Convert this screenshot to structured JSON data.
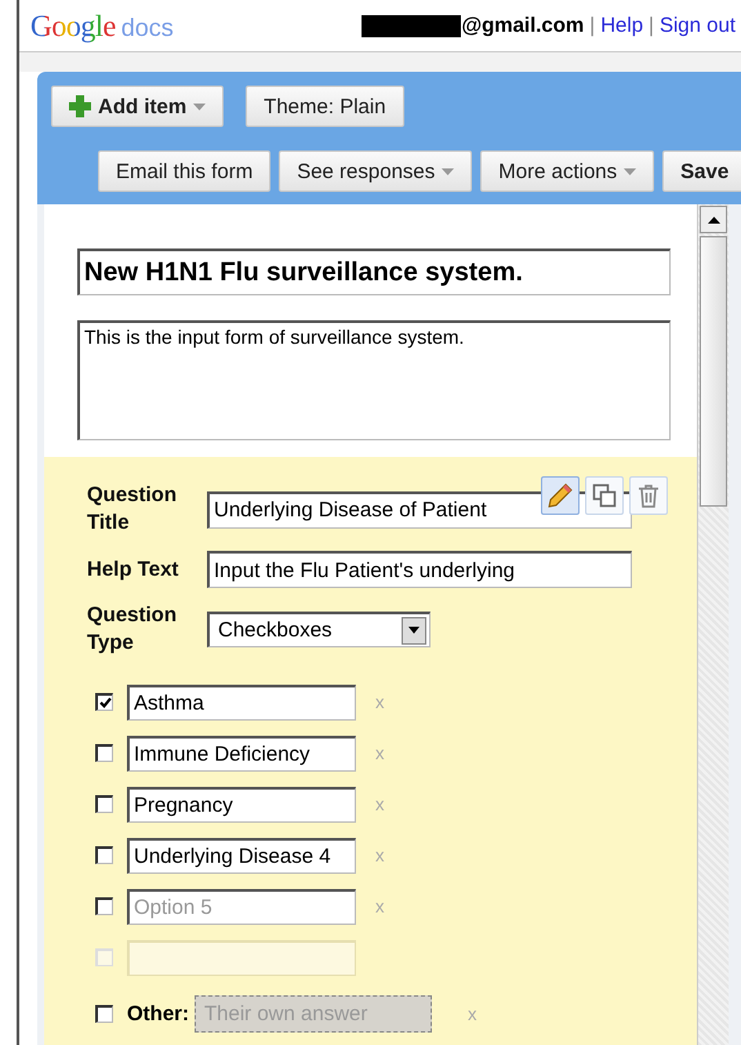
{
  "header": {
    "logo": "Google",
    "product": "docs",
    "account": "@gmail.com",
    "links": [
      {
        "separator": "|",
        "label": "Help"
      },
      {
        "separator": "|",
        "label": "Sign out"
      }
    ]
  },
  "toolbar": {
    "row_1": [
      {
        "kind": "add",
        "label": "Add item",
        "menu": true
      },
      {
        "kind": "plain",
        "label": "Theme:  Plain",
        "menu": false
      }
    ],
    "row_2": [
      {
        "kind": "plain",
        "label": "Email this form",
        "menu": false
      },
      {
        "kind": "plain",
        "label": "See responses",
        "menu": true
      },
      {
        "kind": "plain",
        "label": "More actions",
        "menu": true
      },
      {
        "kind": "bold",
        "label": "Save",
        "menu": false
      }
    ]
  },
  "form": {
    "title": "New H1N1 Flu surveillance system.",
    "description": "This is the input form of surveillance system.",
    "question": {
      "title_label": "Question Title",
      "title_value": "Underlying Disease of Patient",
      "help_label": "Help Text",
      "help_value": "Input the Flu Patient's underlying",
      "type_label": "Question Type",
      "type_value": "Checkboxes",
      "options": [
        {
          "kind": "option",
          "value": "Asthma",
          "checked": true,
          "remove": "x"
        },
        {
          "kind": "option",
          "value": "Immune Deficiency",
          "checked": false,
          "remove": "x"
        },
        {
          "kind": "option",
          "value": "Pregnancy",
          "checked": false,
          "remove": "x"
        },
        {
          "kind": "option",
          "value": "Underlying Disease 4",
          "checked": false,
          "remove": "x"
        },
        {
          "kind": "option",
          "placeholder": "Option 5",
          "checked": false,
          "remove": "x"
        },
        {
          "kind": "new",
          "checked": false,
          "disabled": true
        }
      ],
      "other": {
        "label": "Other:",
        "placeholder": "Their own answer",
        "checked": false,
        "remove": "x"
      }
    }
  }
}
